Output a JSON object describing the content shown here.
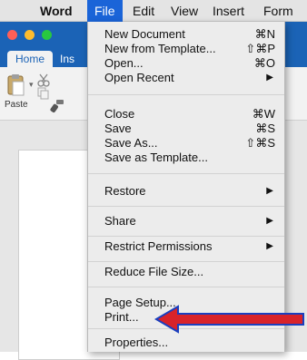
{
  "menubar": {
    "apple_symbol": "",
    "items": [
      "Word",
      "File",
      "Edit",
      "View",
      "Insert",
      "Form"
    ]
  },
  "ribbon": {
    "tabs": [
      "Home",
      "Ins"
    ],
    "paste_label": "Paste"
  },
  "file_menu": {
    "groups": [
      [
        {
          "label": "New Document",
          "shortcut": "⌘N"
        },
        {
          "label": "New from Template...",
          "shortcut": "⇧⌘P"
        },
        {
          "label": "Open...",
          "shortcut": "⌘O"
        },
        {
          "label": "Open Recent",
          "submenu": true
        }
      ],
      [
        {
          "label": "Close",
          "shortcut": "⌘W"
        },
        {
          "label": "Save",
          "shortcut": "⌘S"
        },
        {
          "label": "Save As...",
          "shortcut": "⇧⌘S"
        },
        {
          "label": "Save as Template..."
        }
      ],
      [
        {
          "label": "Restore",
          "submenu": true
        }
      ],
      [
        {
          "label": "Share",
          "submenu": true
        }
      ],
      [
        {
          "label": "Restrict Permissions",
          "submenu": true
        }
      ],
      [
        {
          "label": "Reduce File Size..."
        }
      ],
      [
        {
          "label": "Page Setup..."
        },
        {
          "label": "Print..."
        }
      ],
      [
        {
          "label": "Properties..."
        }
      ]
    ]
  },
  "colors": {
    "menu_highlight": "#1a64d8",
    "word_blue": "#1b63b6",
    "annotation_arrow": "#d8232a",
    "annotation_arrow_outline": "#1a3fbf"
  },
  "icons": [
    "apple-icon",
    "cut-icon",
    "copy-icon",
    "paste-icon",
    "format-painter-icon",
    "submenu-arrow-icon",
    "annotation-arrow"
  ]
}
